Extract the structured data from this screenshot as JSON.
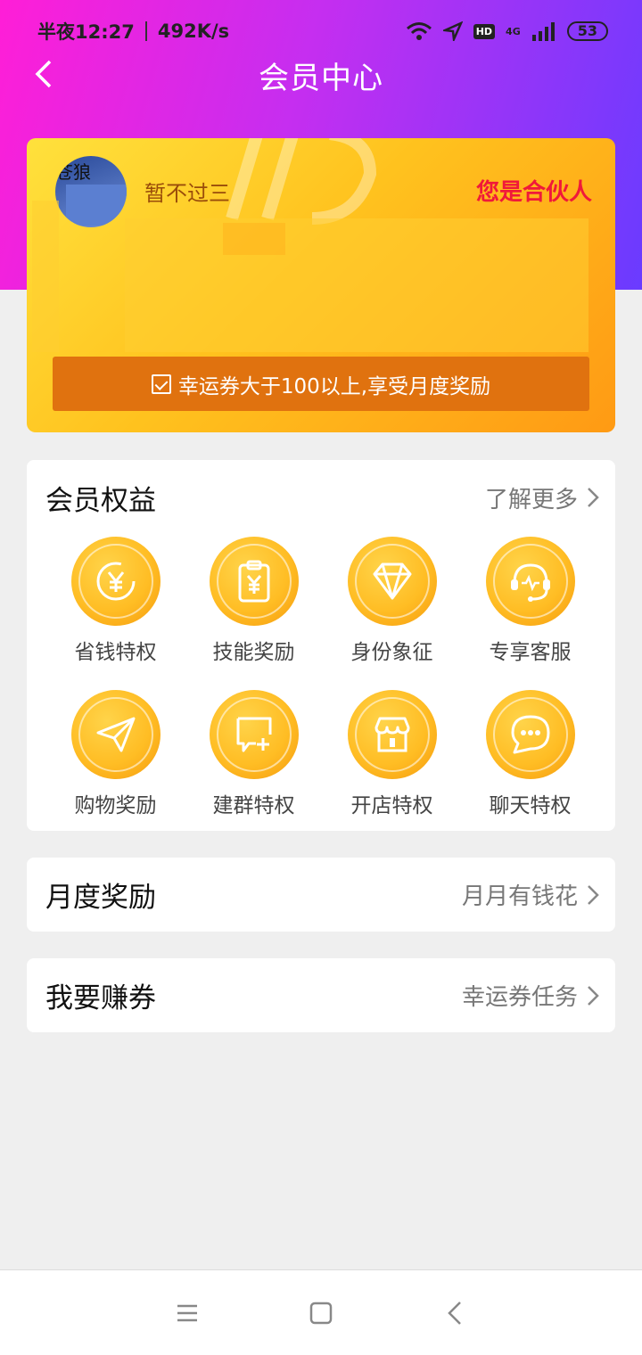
{
  "status_bar": {
    "time": "半夜12:27",
    "speed": "492K/s",
    "battery": "53",
    "hd": "HD",
    "network": "4G"
  },
  "nav": {
    "title": "会员中心",
    "back_icon": "chevron-left-icon"
  },
  "member_card": {
    "avatar_text": "苍狼",
    "nickname": "暂不过三",
    "partner_label": "您是合伙人",
    "task_text": "幸运券大于100以上,享受月度奖励"
  },
  "benefits": {
    "title": "会员权益",
    "more": "了解更多",
    "items": [
      {
        "label": "省钱特权",
        "icon": "yen-cycle-icon"
      },
      {
        "label": "技能奖励",
        "icon": "yen-clipboard-icon"
      },
      {
        "label": "身份象征",
        "icon": "diamond-icon"
      },
      {
        "label": "专享客服",
        "icon": "headset-icon"
      },
      {
        "label": "购物奖励",
        "icon": "paper-plane-icon"
      },
      {
        "label": "建群特权",
        "icon": "chat-add-icon"
      },
      {
        "label": "开店特权",
        "icon": "shop-icon"
      },
      {
        "label": "聊天特权",
        "icon": "chat-bubble-icon"
      }
    ]
  },
  "monthly_reward": {
    "title": "月度奖励",
    "link": "月月有钱花"
  },
  "earn_coupons": {
    "title": "我要赚券",
    "link": "幸运券任务"
  },
  "colors": {
    "accent": "#e0720f",
    "partner": "#f0193a",
    "card": "#ffc21e"
  }
}
